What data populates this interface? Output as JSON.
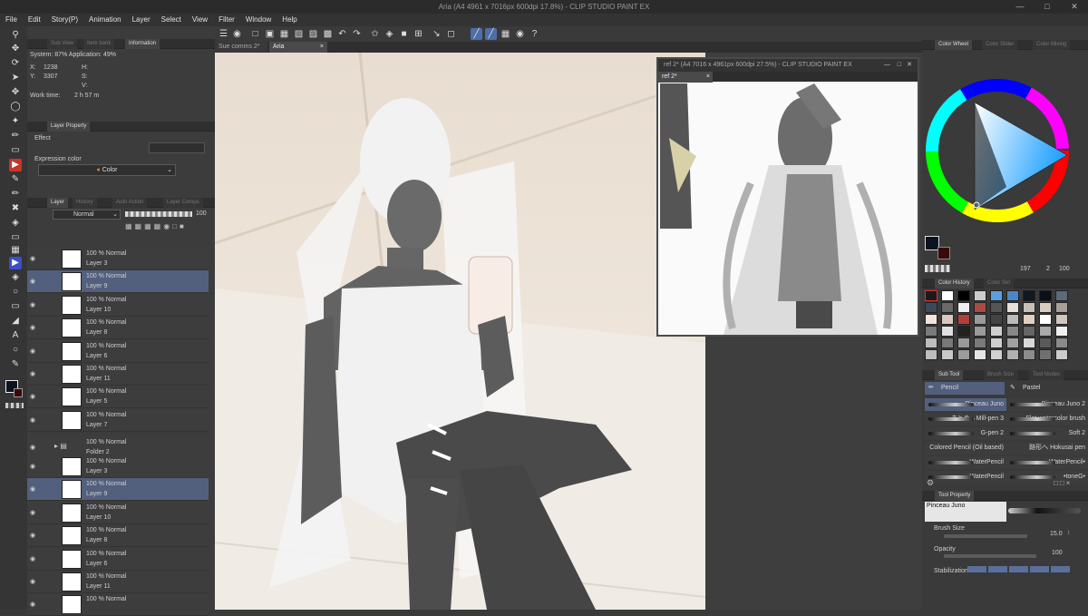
{
  "window": {
    "title": "Aria (A4 4961 x 7016px 600dpi 17.8%) - CLIP STUDIO PAINT EX"
  },
  "menu": [
    "File",
    "Edit",
    "Story(P)",
    "Animation",
    "Layer",
    "Select",
    "View",
    "Filter",
    "Window",
    "Help"
  ],
  "doc_tabs": [
    "Sue comms 2*",
    "Aria"
  ],
  "info_panel": {
    "tabs": [
      "Sub View",
      "Item bank",
      "Information"
    ],
    "system": "System: 87% Application: 49%",
    "x_label": "X:",
    "x_value": "1238",
    "y_label": "Y:",
    "y_value": "3307",
    "h_label": "H:",
    "s_label": "S:",
    "v_label": "V:",
    "work_time_label": "Work time:",
    "work_time_value": "2 h 57 m"
  },
  "layer_property": {
    "tab": "Layer Property",
    "effect_label": "Effect",
    "expression_label": "Expression color",
    "expression_value": "Color"
  },
  "layer_panel": {
    "tabs": [
      "Layer",
      "History",
      "Auto Action",
      "Layer Comps"
    ],
    "blend_mode": "Normal",
    "opacity": "100",
    "layers": [
      {
        "mode": "100 % Normal",
        "name": "Layer 3",
        "hl": false
      },
      {
        "mode": "100 % Normal",
        "name": "Layer 9",
        "hl": true
      },
      {
        "mode": "100 % Normal",
        "name": "Layer 10",
        "hl": false
      },
      {
        "mode": "100 % Normal",
        "name": "Layer 8",
        "hl": false
      },
      {
        "mode": "100 % Normal",
        "name": "Layer 6",
        "hl": false
      },
      {
        "mode": "100 % Normal",
        "name": "Layer 11",
        "hl": false
      },
      {
        "mode": "100 % Normal",
        "name": "Layer 5",
        "hl": false
      },
      {
        "mode": "100 % Normal",
        "name": "Layer 7",
        "hl": false
      }
    ],
    "folder": {
      "mode": "100 % Normal",
      "name": "Folder 2"
    },
    "layers2": [
      {
        "mode": "100 % Normal",
        "name": "Layer 3",
        "hl": false
      },
      {
        "mode": "100 % Normal",
        "name": "Layer 9",
        "hl": true
      },
      {
        "mode": "100 % Normal",
        "name": "Layer 10",
        "hl": false
      },
      {
        "mode": "100 % Normal",
        "name": "Layer 8",
        "hl": false
      },
      {
        "mode": "100 % Normal",
        "name": "Layer 6",
        "hl": false
      },
      {
        "mode": "100 % Normal",
        "name": "Layer 11",
        "hl": false
      },
      {
        "mode": "100 % Normal",
        "name": ""
      }
    ]
  },
  "reference_window": {
    "title": "ref 2* (A4 7016 x 4961px 600dpi 27.5%) - CLIP STUDIO PAINT EX",
    "tab": "ref 2*"
  },
  "color_panel": {
    "tabs": [
      "Color Wheel",
      "Color Slider",
      "Color Mixing"
    ],
    "readout_h": "197",
    "readout_s": "2",
    "readout_v": "100",
    "main_color": "#0b1220",
    "sub_color": "#3a0a0a"
  },
  "color_history": {
    "tabs": [
      "Color History",
      "Color Set"
    ],
    "swatches": [
      "#1a1a1a",
      "#ffffff",
      "#000000",
      "#cccccc",
      "#5aa0e0",
      "#4a86c8",
      "#101820",
      "#0a0f18",
      "#5a6a7a",
      "#3a4a5a",
      "#6a6a6a",
      "#eeeeee",
      "#a94a44",
      "#555555",
      "#e8e0d8",
      "#c8c0b8",
      "#d8ccc0",
      "#a8a098",
      "#f2e4dc",
      "#d8c8c0",
      "#b04038",
      "#9a9a9a",
      "#444444",
      "#bbbbbb",
      "#e0d0c0",
      "#ffffff",
      "#d0c8c0",
      "#7a7a7a",
      "#e0e0e0",
      "#222222",
      "#9a9a9a",
      "#cfcfcf",
      "#888888",
      "#666666",
      "#aaaaaa",
      "#efefef",
      "#bcbcbc",
      "#787878",
      "#9a9a9a",
      "#7a7a7a",
      "#cfcfcf",
      "#a0a0a0",
      "#d8d8d8",
      "#5a5a5a",
      "#8a8a8a",
      "#bdbdbd",
      "#c8c8c8",
      "#9c9c9c",
      "#e6e6e6",
      "#d0d0d0",
      "#b0b0b0",
      "#8c8c8c",
      "#707070",
      "#cccccc"
    ]
  },
  "sub_tool": {
    "tabs": [
      "Sub Tool",
      "Brush Size",
      "Tool Nodes"
    ],
    "groups": [
      "Pencil",
      "Pastel"
    ],
    "brushes_left": [
      "Pinceau Juno",
      "まとめ→Mill-pen 3",
      "G-pen 2",
      "Colored Pencil (Oil based)",
      "WaterPencil",
      "WaterPencil"
    ],
    "brushes_right": [
      "Pinceau Juno 2",
      "Flat watercolor brush",
      "Soft 2",
      "跡形へ Hokusai pen",
      "WaterPencil•",
      "•toneG•"
    ]
  },
  "tool_property": {
    "tab": "Tool Property",
    "brush_name": "Pinceau Juno",
    "size_label": "Brush Size",
    "size_value": "15.0",
    "opacity_label": "Opacity",
    "opacity_value": "100",
    "stabilization_label": "Stabilization"
  }
}
